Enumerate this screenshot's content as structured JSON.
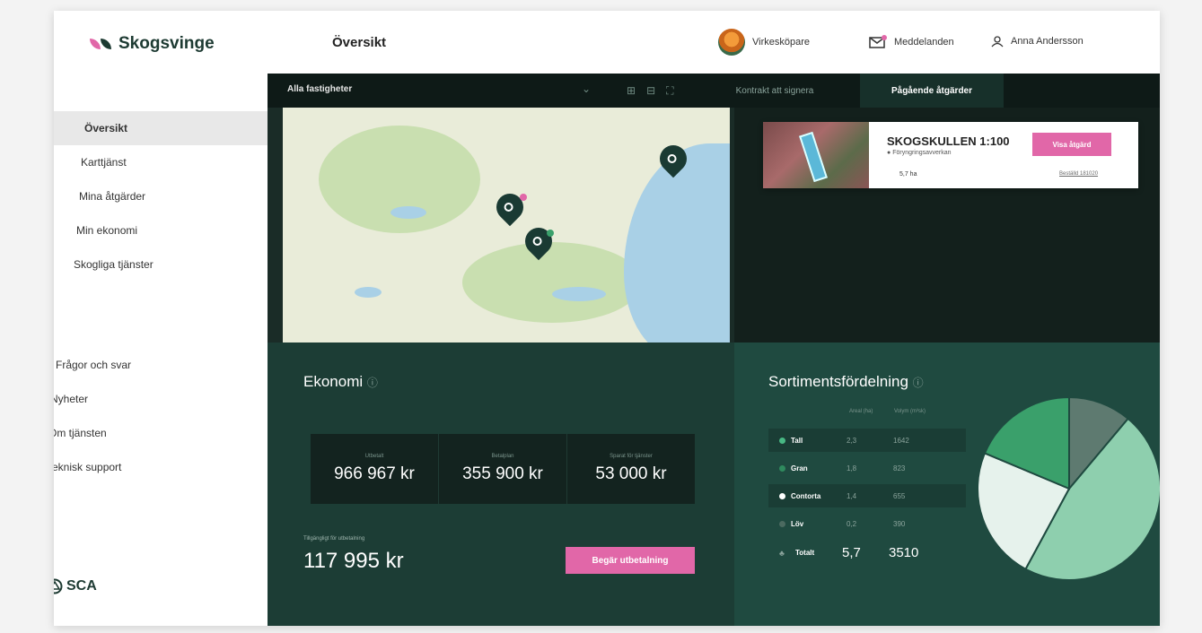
{
  "app": {
    "brand": "Skogsvinge",
    "page_title": "Översikt"
  },
  "header": {
    "seller_label": "Virkesköpare",
    "messages_label": "Meddelanden",
    "user_name": "Anna Andersson"
  },
  "sidebar": {
    "items": [
      {
        "label": "Översikt",
        "active": true,
        "dot": true
      },
      {
        "label": "Karttjänst",
        "active": false,
        "dot": false
      },
      {
        "label": "Mina åtgärder",
        "active": false,
        "dot": true
      },
      {
        "label": "Min ekonomi",
        "active": false,
        "dot": false
      },
      {
        "label": "Skogliga tjänster",
        "active": false,
        "dot": false
      }
    ],
    "links": [
      "Frågor och svar",
      "Nyheter",
      "Om tjänsten",
      "Teknisk support"
    ],
    "company": "SCA"
  },
  "toolbar": {
    "filter_label": "Alla fastigheter",
    "tabs": [
      {
        "label": "Kontrakt att signera",
        "active": false
      },
      {
        "label": "Pågående åtgärder",
        "active": true
      }
    ]
  },
  "action_card": {
    "title": "SKOGSKULLEN 1:100",
    "subtitle": "Föryngringsavverkan",
    "area": "5,7 ha",
    "button": "Visa åtgärd",
    "link": "Beställd 181020"
  },
  "economy": {
    "title": "Ekonomi",
    "stats": [
      {
        "label": "Utbetalt",
        "value": "966 967 kr"
      },
      {
        "label": "Betalplan",
        "value": "355 900 kr"
      },
      {
        "label": "Sparat för tjänster",
        "value": "53 000 kr"
      }
    ],
    "available_label": "Tillgängligt för utbetalning",
    "available_value": "117 995 kr",
    "pay_button": "Begär utbetalning"
  },
  "sortiment": {
    "title": "Sortimentsfördelning",
    "col_area": "Areal (ha)",
    "col_volume": "Volym (m³sk)",
    "rows": [
      {
        "name": "Tall",
        "area": "2,3",
        "volume": "1642",
        "color": "#48b884"
      },
      {
        "name": "Gran",
        "area": "1,8",
        "volume": "823",
        "color": "#2f8a5e"
      },
      {
        "name": "Contorta",
        "area": "1,4",
        "volume": "655",
        "color": "#ffffff"
      },
      {
        "name": "Löv",
        "area": "0,2",
        "volume": "390",
        "color": "#4b6a60"
      }
    ],
    "total_label": "Totalt",
    "total_area": "5,7",
    "total_volume": "3510"
  },
  "colors": {
    "accent_pink": "#e167a8",
    "dark_green": "#1c3d35",
    "sidebar_dot": "#3aa06b"
  }
}
